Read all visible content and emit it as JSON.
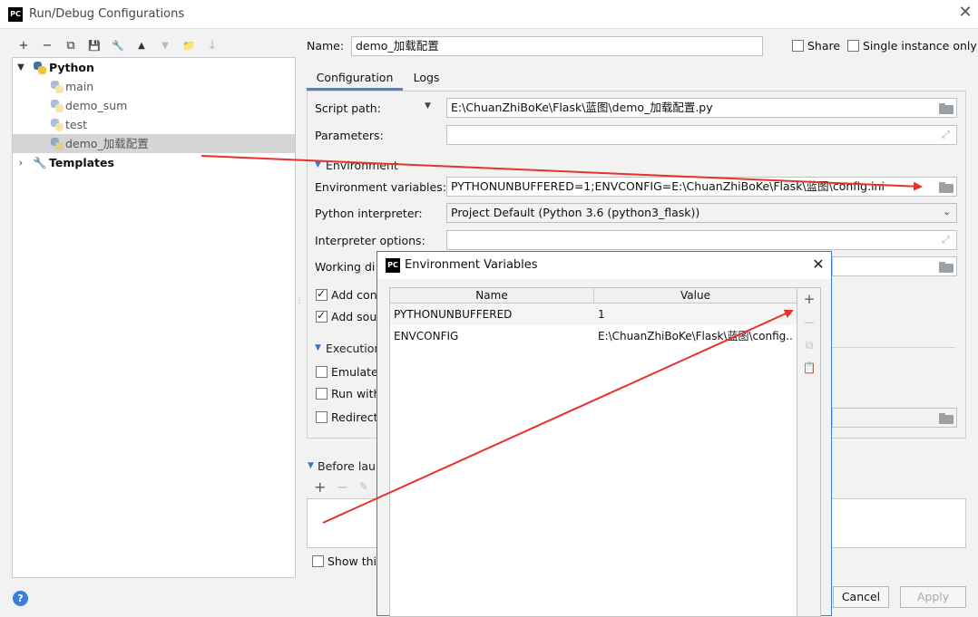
{
  "window": {
    "title": "Run/Debug Configurations",
    "logo_text": "PC",
    "close_glyph": "✕"
  },
  "toolbar": {
    "add": "+",
    "remove": "−",
    "copy": "⧉",
    "save": "💾",
    "edit": "🔧",
    "up": "▲",
    "down": "▼",
    "folder": "📁",
    "sort": "↓"
  },
  "tree": {
    "python_group": "Python",
    "items": [
      "main",
      "demo_sum",
      "test",
      "demo_加载配置"
    ],
    "selected": "demo_加载配置",
    "templates": "Templates"
  },
  "config": {
    "name_label": "Name:",
    "name_value": "demo_加载配置",
    "share_label": "Share",
    "single_instance_label": "Single instance only",
    "tabs": [
      "Configuration",
      "Logs"
    ],
    "script_path_label": "Script path:",
    "script_path_value": "E:\\ChuanZhiBoKe\\Flask\\蓝图\\demo_加载配置.py",
    "parameters_label": "Parameters:",
    "environment_section": "Environment",
    "env_vars_label": "Environment variables:",
    "env_vars_value": "PYTHONUNBUFFERED=1;ENVCONFIG=E:\\ChuanZhiBoKe\\Flask\\蓝图\\config.ini",
    "interpreter_label": "Python interpreter:",
    "interpreter_value": "Project Default (Python 3.6 (python3_flask))",
    "interpreter_options_label": "Interpreter options:",
    "working_dir_label": "Working di",
    "add_content_label": "Add con",
    "add_source_label": "Add sou",
    "execution_section": "Execution",
    "emulate_label": "Emulate",
    "run_with_label": "Run with",
    "redirect_label": "Redirect",
    "before_launch_label": "Before launc",
    "show_this_label": "Show this",
    "cancel_button": "Cancel",
    "apply_button": "Apply"
  },
  "env_dialog": {
    "title": "Environment Variables",
    "logo_text": "PC",
    "close_glyph": "✕",
    "columns": [
      "Name",
      "Value"
    ],
    "rows": [
      {
        "name": "PYTHONUNBUFFERED",
        "value": "1"
      },
      {
        "name": "ENVCONFIG",
        "value": "E:\\ChuanZhiBoKe\\Flask\\蓝图\\config...."
      }
    ],
    "tools": {
      "add": "+",
      "remove": "−",
      "copy": "⧉",
      "paste": "📋"
    }
  },
  "help_glyph": "?",
  "colors": {
    "accent": "#4a86c8",
    "annotation_arrow": "#e8302c"
  }
}
